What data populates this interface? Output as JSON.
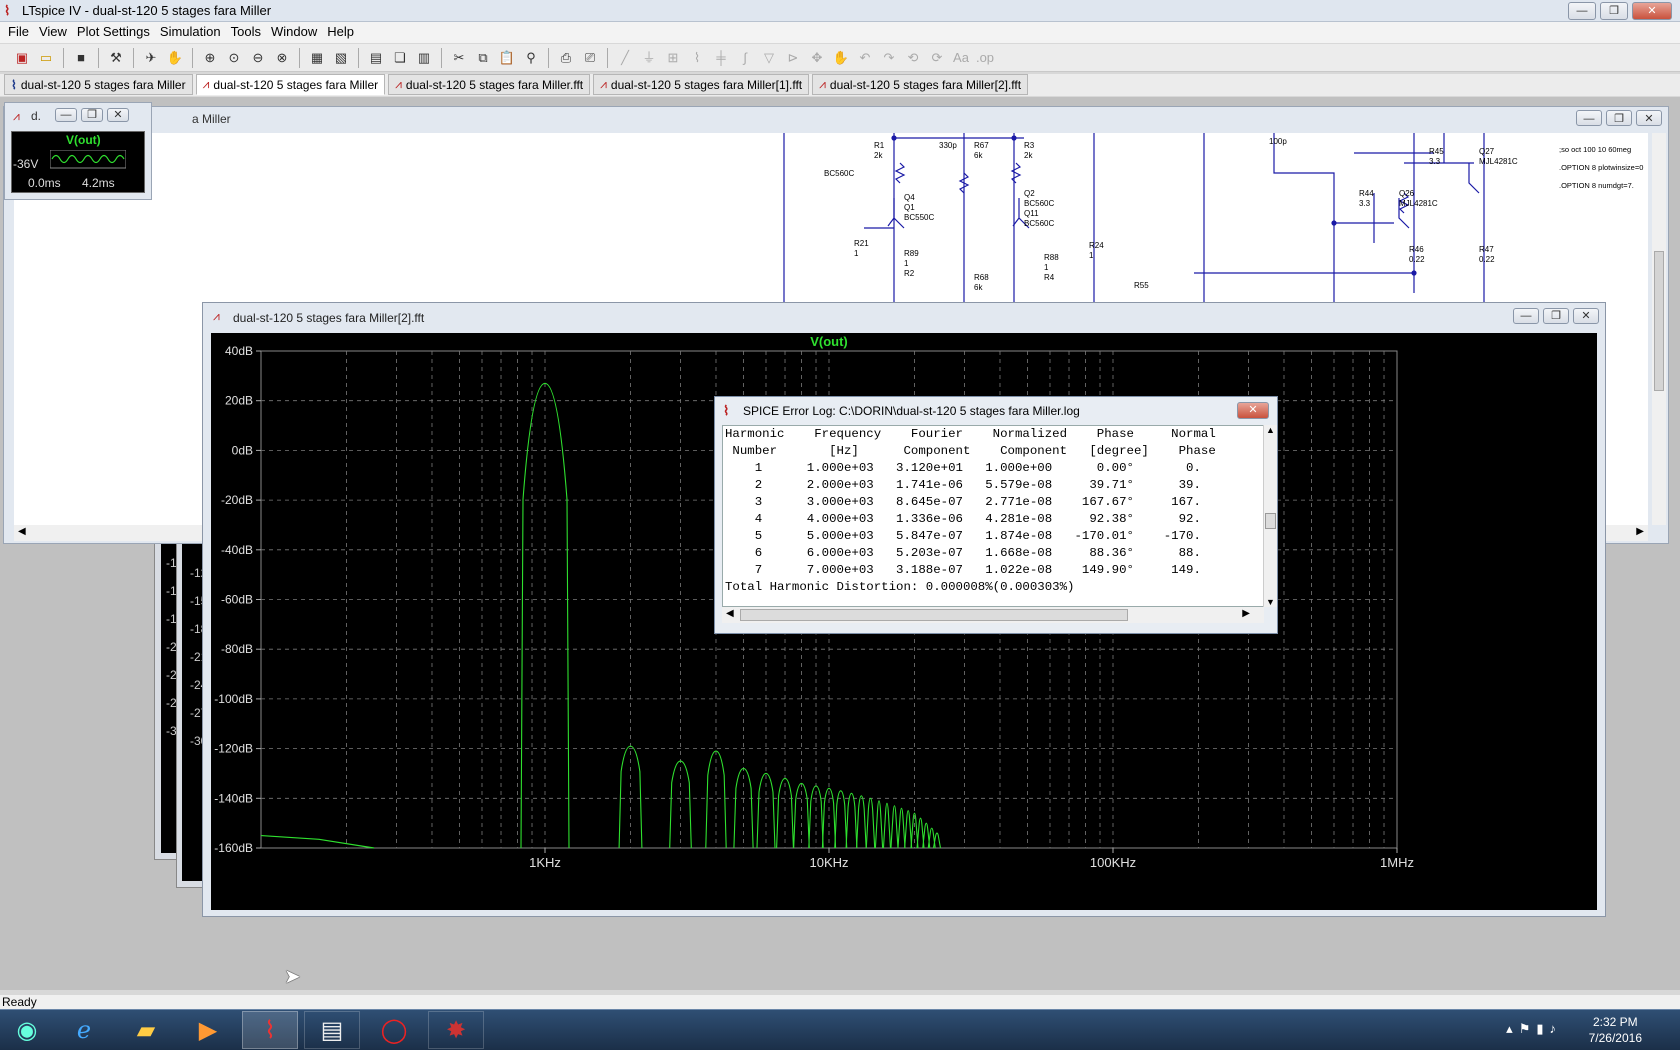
{
  "app": {
    "title": "LTspice IV - dual-st-120 5 stages fara Miller",
    "menu": [
      "File",
      "View",
      "Plot Settings",
      "Simulation",
      "Tools",
      "Window",
      "Help"
    ],
    "tabs": [
      {
        "label": "dual-st-120 5 stages fara Miller",
        "icon": "schematic-icon"
      },
      {
        "label": "dual-st-120 5 stages fara Miller",
        "icon": "waveform-icon",
        "active": true
      },
      {
        "label": "dual-st-120 5 stages fara Miller.fft",
        "icon": "waveform-icon"
      },
      {
        "label": "dual-st-120 5 stages fara Miller[1].fft",
        "icon": "waveform-icon"
      },
      {
        "label": "dual-st-120 5 stages fara Miller[2].fft",
        "icon": "waveform-icon"
      }
    ],
    "status": "Ready"
  },
  "schematic_window": {
    "title_left": "d.",
    "title_right": "a Miller",
    "labels": [
      "R1",
      "2k",
      "R67",
      "6k",
      "R3",
      "2k",
      "R45",
      "3.3",
      "Q27",
      "MJL4281C",
      "R44",
      "3.3",
      "Q26",
      "MJL4281C",
      "R46",
      "0.22",
      "R47",
      "0.22",
      "Q4",
      "Q1",
      "BC550C",
      "R21",
      "1",
      "R89",
      "1",
      "R2",
      "R68",
      "6k",
      "Q2",
      "BC560C",
      "Q11",
      "BC560C",
      "R88",
      "1",
      "R4",
      "R24",
      "1",
      "BC560C",
      "R55",
      "330p",
      "100p"
    ],
    "directives": [
      ";so oct 100 10 60meg",
      ".OPTION 8 plotwinsize=0",
      ".OPTION 8 numdgt=7."
    ]
  },
  "mini_wave": {
    "trace": "V(out)",
    "y": "-36V",
    "x_start": "0.0ms",
    "x_end": "4.2ms"
  },
  "background_axis_labels": [
    "-12",
    "-15",
    "-18",
    "-21",
    "-24",
    "-27",
    "-30",
    "-12",
    "-15",
    "-18",
    "-21",
    "-24",
    "-27",
    "-30"
  ],
  "fft_window": {
    "title": "dual-st-120 5 stages fara Miller[2].fft",
    "trace": "V(out)"
  },
  "chart_data": {
    "type": "line",
    "title": "",
    "series": [
      {
        "name": "V(out)",
        "color": "#2fe02f"
      }
    ],
    "x_scale": "log",
    "xlim_hz": [
      100,
      1000000
    ],
    "x_ticks": [
      "1KHz",
      "10KHz",
      "100KHz",
      "1MHz"
    ],
    "ylim_db": [
      -160,
      40
    ],
    "y_ticks": [
      "40dB",
      "20dB",
      "0dB",
      "-20dB",
      "-40dB",
      "-60dB",
      "-80dB",
      "-100dB",
      "-120dB",
      "-140dB",
      "-160dB"
    ],
    "grid": true,
    "peaks": [
      {
        "f_hz": 1000,
        "db": 27
      },
      {
        "f_hz": 2000,
        "db": -119
      },
      {
        "f_hz": 3000,
        "db": -125
      },
      {
        "f_hz": 4000,
        "db": -121
      },
      {
        "f_hz": 5000,
        "db": -128
      },
      {
        "f_hz": 6000,
        "db": -130
      },
      {
        "f_hz": 7000,
        "db": -132
      },
      {
        "f_hz": 8000,
        "db": -134
      },
      {
        "f_hz": 9000,
        "db": -135
      },
      {
        "f_hz": 10000,
        "db": -136
      },
      {
        "f_hz": 11000,
        "db": -137
      },
      {
        "f_hz": 12000,
        "db": -138
      },
      {
        "f_hz": 13000,
        "db": -139
      },
      {
        "f_hz": 14000,
        "db": -140
      },
      {
        "f_hz": 15000,
        "db": -141
      },
      {
        "f_hz": 16000,
        "db": -142
      },
      {
        "f_hz": 17000,
        "db": -143
      },
      {
        "f_hz": 18000,
        "db": -144
      },
      {
        "f_hz": 19000,
        "db": -145
      },
      {
        "f_hz": 20000,
        "db": -146
      },
      {
        "f_hz": 21000,
        "db": -148
      },
      {
        "f_hz": 22000,
        "db": -150
      },
      {
        "f_hz": 23000,
        "db": -152
      },
      {
        "f_hz": 24000,
        "db": -154
      }
    ],
    "low_freq_tail": [
      [
        100,
        -155
      ],
      [
        160,
        -156.5
      ],
      [
        250,
        -160
      ]
    ]
  },
  "error_log": {
    "title": "SPICE Error Log: C:\\DORIN\\dual-st-120 5 stages fara Miller.log",
    "lines": [
      "Harmonic    Frequency    Fourier    Normalized    Phase     Normal",
      " Number       [Hz]      Component    Component   [degree]    Phase",
      "    1      1.000e+03   3.120e+01   1.000e+00      0.00°       0.",
      "    2      2.000e+03   1.741e-06   5.579e-08     39.71°      39.",
      "    3      3.000e+03   8.645e-07   2.771e-08    167.67°     167.",
      "    4      4.000e+03   1.336e-06   4.281e-08     92.38°      92.",
      "    5      5.000e+03   5.847e-07   1.874e-08   -170.01°    -170.",
      "    6      6.000e+03   5.203e-07   1.668e-08     88.36°      88.",
      "    7      7.000e+03   3.188e-07   1.022e-08    149.90°     149.",
      "Total Harmonic Distortion: 0.000008%(0.000303%)"
    ]
  },
  "taskbar": {
    "apps": [
      "start-orb-icon",
      "internet-explorer-icon",
      "file-explorer-icon",
      "media-player-icon",
      "ltspice-icon",
      "notepad-icon",
      "opera-icon",
      "app-icon"
    ],
    "time": "2:32 PM",
    "date": "7/26/2016"
  }
}
